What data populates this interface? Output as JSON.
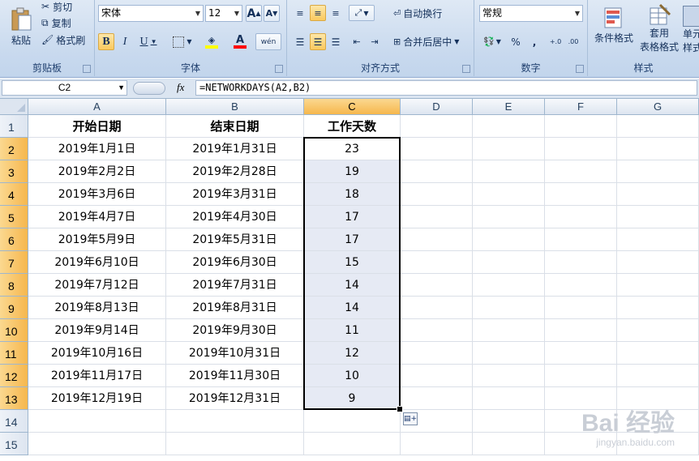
{
  "ribbon": {
    "clipboard": {
      "label": "剪贴板",
      "paste": "粘贴",
      "cut": "剪切",
      "copy": "复制",
      "format_painter": "格式刷"
    },
    "font": {
      "label": "字体",
      "font_name": "宋体",
      "font_size": "12",
      "grow": "A",
      "shrink": "A",
      "bold": "B",
      "italic": "I",
      "underline": "U",
      "phonetic": "wén"
    },
    "alignment": {
      "label": "对齐方式",
      "wrap_text": "自动换行",
      "merge_center": "合并后居中"
    },
    "number": {
      "label": "数字",
      "format": "常规",
      "percent": "%",
      "comma": ","
    },
    "styles": {
      "label": "样式",
      "conditional": "条件格式",
      "table_line1": "套用",
      "table_line2": "表格格式",
      "cell_line1": "单元",
      "cell_line2": "样式"
    }
  },
  "formula_bar": {
    "name_box": "C2",
    "fx": "fx",
    "formula": "=NETWORKDAYS(A2,B2)"
  },
  "columns": [
    "A",
    "B",
    "C",
    "D",
    "E",
    "F",
    "G"
  ],
  "rows": [
    {
      "num": "1",
      "a": "开始日期",
      "b": "结束日期",
      "c": "工作天数"
    },
    {
      "num": "2",
      "a": "2019年1月1日",
      "b": "2019年1月31日",
      "c": "23"
    },
    {
      "num": "3",
      "a": "2019年2月2日",
      "b": "2019年2月28日",
      "c": "19"
    },
    {
      "num": "4",
      "a": "2019年3月6日",
      "b": "2019年3月31日",
      "c": "18"
    },
    {
      "num": "5",
      "a": "2019年4月7日",
      "b": "2019年4月30日",
      "c": "17"
    },
    {
      "num": "6",
      "a": "2019年5月9日",
      "b": "2019年5月31日",
      "c": "17"
    },
    {
      "num": "7",
      "a": "2019年6月10日",
      "b": "2019年6月30日",
      "c": "15"
    },
    {
      "num": "8",
      "a": "2019年7月12日",
      "b": "2019年7月31日",
      "c": "14"
    },
    {
      "num": "9",
      "a": "2019年8月13日",
      "b": "2019年8月31日",
      "c": "14"
    },
    {
      "num": "10",
      "a": "2019年9月14日",
      "b": "2019年9月30日",
      "c": "11"
    },
    {
      "num": "11",
      "a": "2019年10月16日",
      "b": "2019年10月31日",
      "c": "12"
    },
    {
      "num": "12",
      "a": "2019年11月17日",
      "b": "2019年11月30日",
      "c": "10"
    },
    {
      "num": "13",
      "a": "2019年12月19日",
      "b": "2019年12月31日",
      "c": "9"
    },
    {
      "num": "14",
      "a": "",
      "b": "",
      "c": ""
    },
    {
      "num": "15",
      "a": "",
      "b": "",
      "c": ""
    }
  ],
  "watermark": {
    "logo": "Bai 经验",
    "url": "jingyan.baidu.com"
  }
}
